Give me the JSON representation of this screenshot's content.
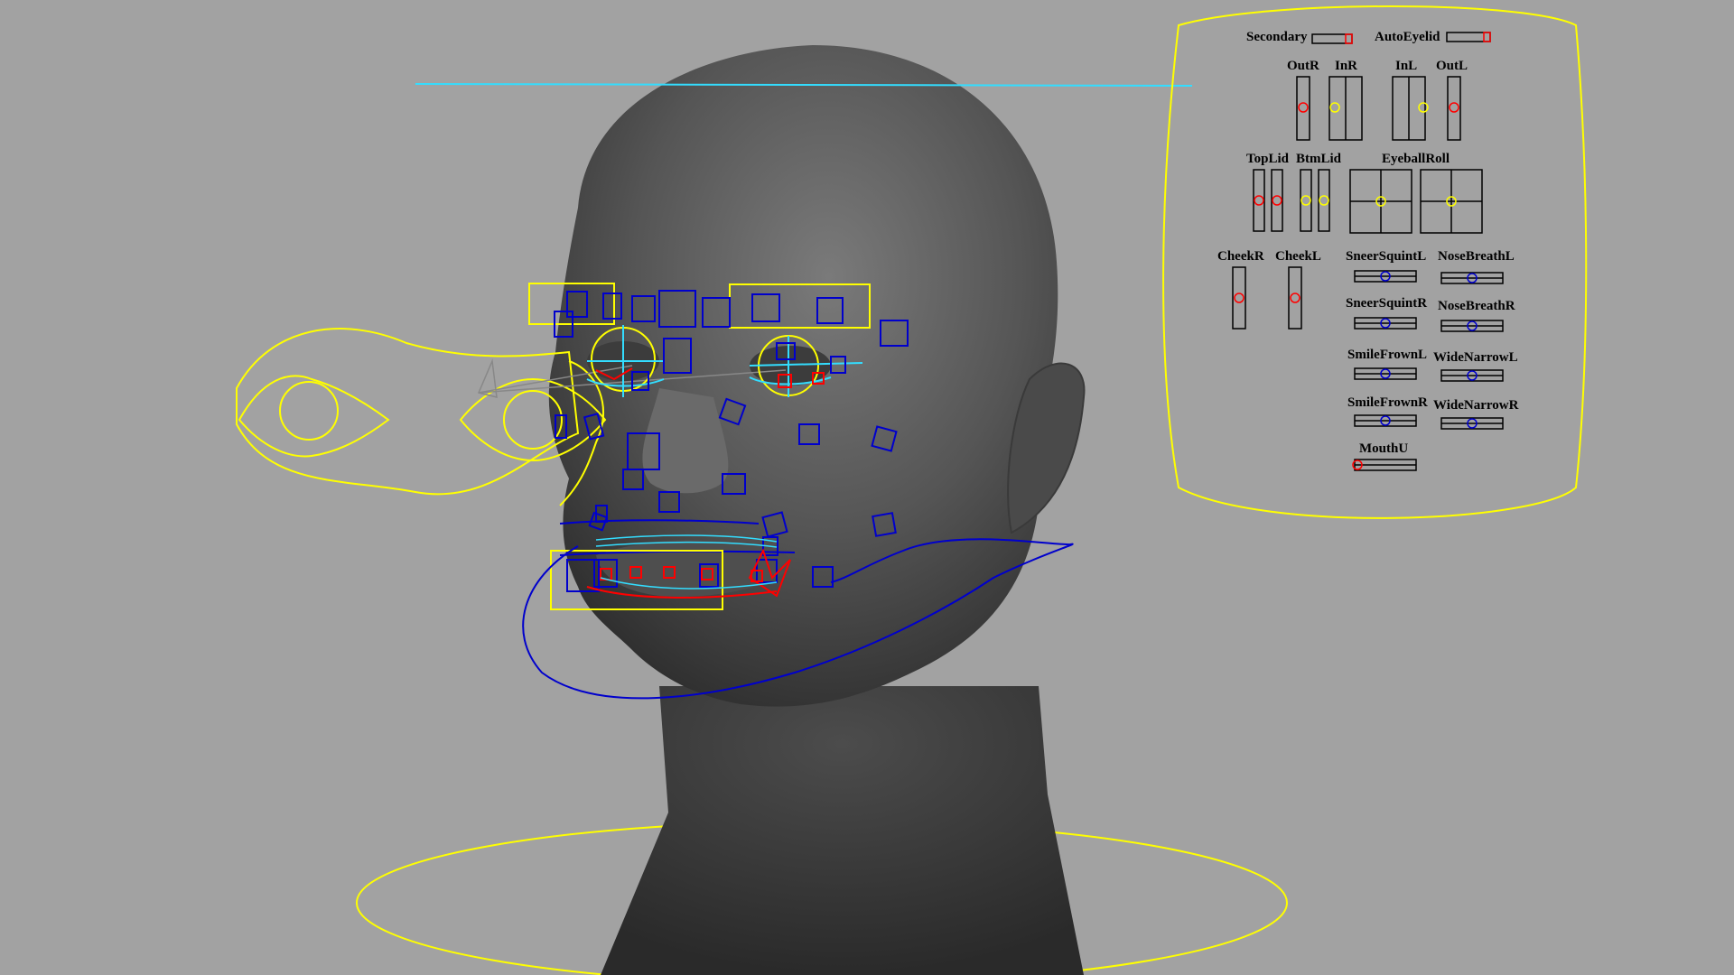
{
  "viewport": {
    "background": "#a2a2a2",
    "head_color": "#5a5a5a",
    "curve_colors": {
      "selected": "#ffff00",
      "control": "#0000cc",
      "secondary": "#ff0000",
      "cyan": "#33ddff"
    }
  },
  "control_panel": {
    "secondary_label": "Secondary",
    "autoeyelid_label": "AutoEyelid",
    "outr_label": "OutR",
    "inr_label": "InR",
    "inl_label": "InL",
    "outl_label": "OutL",
    "toplid_label": "TopLid",
    "btmlid_label": "BtmLid",
    "eyeballroll_label": "EyeballRoll",
    "cheekr_label": "CheekR",
    "cheekl_label": "CheekL",
    "sneersquintl_label": "SneerSquintL",
    "nosebreathl_label": "NoseBreathL",
    "sneersquintr_label": "SneerSquintR",
    "nosebreathr_label": "NoseBreathR",
    "smilefrownl_label": "SmileFrownL",
    "widenarrowl_label": "WideNarrowL",
    "smilefrownr_label": "SmileFrownR",
    "widenarrowr_label": "WideNarrowR",
    "mouthu_label": "MouthU"
  }
}
